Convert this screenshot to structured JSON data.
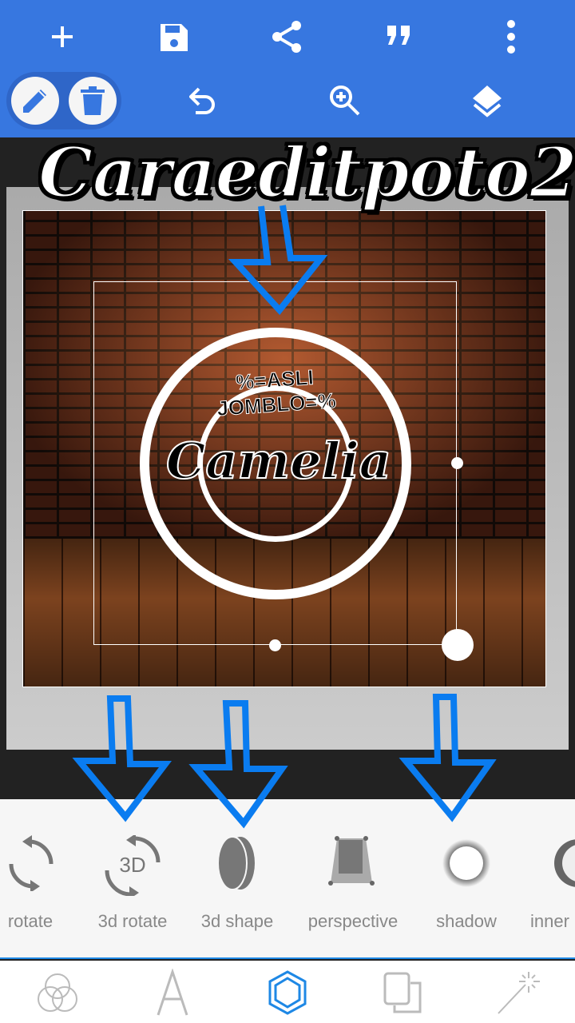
{
  "toolbar": {
    "row1": [
      "add-icon",
      "save-icon",
      "share-icon",
      "quote-icon",
      "more-vert-icon"
    ],
    "row2": [
      "edit-icon",
      "delete-icon",
      "undo-icon",
      "zoom-in-icon",
      "layers-icon"
    ]
  },
  "canvas": {
    "title_text": "Caraeditpoto2",
    "emblem_top": "%=ASLI JOMBLO=%",
    "emblem_name": "Camelia"
  },
  "tools": [
    {
      "label": "rotate",
      "icon": "rotate-icon"
    },
    {
      "label": "3d rotate",
      "icon": "3d-rotate-icon",
      "badge": "3D"
    },
    {
      "label": "3d shape",
      "icon": "3d-shape-icon"
    },
    {
      "label": "perspective",
      "icon": "perspective-icon"
    },
    {
      "label": "shadow",
      "icon": "shadow-icon"
    },
    {
      "label": "inner",
      "icon": "inner-shadow-icon"
    }
  ],
  "bottom_nav": [
    {
      "icon": "blend-icon"
    },
    {
      "icon": "text-icon"
    },
    {
      "icon": "shape-icon",
      "active": true
    },
    {
      "icon": "duplicate-icon"
    },
    {
      "icon": "effects-wand-icon"
    }
  ],
  "colors": {
    "toolbar": "#3777e0",
    "accent": "#1e88e5",
    "arrow": "#0a7cf0"
  }
}
